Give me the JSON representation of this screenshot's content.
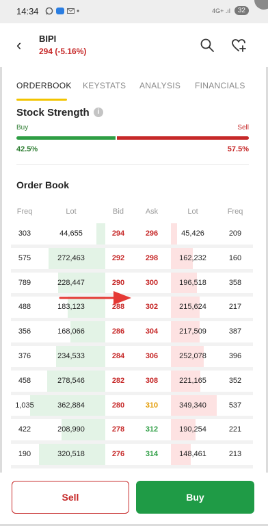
{
  "status_bar": {
    "time": "14:34",
    "icons": [
      "whatsapp-icon",
      "app-icon",
      "mail-icon",
      "dot-icon"
    ],
    "signal": "4G+ .ıl",
    "battery": "32"
  },
  "header": {
    "ticker": "BIPI",
    "price": "294",
    "change": "(-5.16%)"
  },
  "tabs": [
    "ORDERBOOK",
    "KEYSTATS",
    "ANALYSIS",
    "FINANCIALS"
  ],
  "active_tab": "ORDERBOOK",
  "stock_strength": {
    "title": "Stock Strength",
    "info": "i",
    "buy_label": "Buy",
    "sell_label": "Sell",
    "buy_pct": "42.5%",
    "sell_pct": "57.5%",
    "buy_fraction": 0.425
  },
  "order_book": {
    "title": "Order Book",
    "headers": {
      "freq_bid": "Freq",
      "lot_bid": "Lot",
      "bid": "Bid",
      "ask": "Ask",
      "lot_ask": "Lot",
      "freq_ask": "Freq"
    },
    "rows": [
      {
        "freq_bid": "303",
        "lot_bid": "44,655",
        "bid": "294",
        "ask": "296",
        "lot_ask": "45,426",
        "freq_ask": "209",
        "ask_color": "red",
        "bid_fill": 0.12,
        "ask_fill": 0.13
      },
      {
        "freq_bid": "575",
        "lot_bid": "272,463",
        "bid": "292",
        "ask": "298",
        "lot_ask": "162,232",
        "freq_ask": "160",
        "ask_color": "red",
        "bid_fill": 0.75,
        "ask_fill": 0.45
      },
      {
        "freq_bid": "789",
        "lot_bid": "228,447",
        "bid": "290",
        "ask": "300",
        "lot_ask": "196,518",
        "freq_ask": "358",
        "ask_color": "red",
        "bid_fill": 0.63,
        "ask_fill": 0.54
      },
      {
        "freq_bid": "488",
        "lot_bid": "183,123",
        "bid": "288",
        "ask": "302",
        "lot_ask": "215,624",
        "freq_ask": "217",
        "ask_color": "red",
        "bid_fill": 0.5,
        "ask_fill": 0.6
      },
      {
        "freq_bid": "356",
        "lot_bid": "168,066",
        "bid": "286",
        "ask": "304",
        "lot_ask": "217,509",
        "freq_ask": "387",
        "ask_color": "red",
        "bid_fill": 0.46,
        "ask_fill": 0.6
      },
      {
        "freq_bid": "376",
        "lot_bid": "234,533",
        "bid": "284",
        "ask": "306",
        "lot_ask": "252,078",
        "freq_ask": "396",
        "ask_color": "red",
        "bid_fill": 0.65,
        "ask_fill": 0.69
      },
      {
        "freq_bid": "458",
        "lot_bid": "278,546",
        "bid": "282",
        "ask": "308",
        "lot_ask": "221,165",
        "freq_ask": "352",
        "ask_color": "red",
        "bid_fill": 0.77,
        "ask_fill": 0.61
      },
      {
        "freq_bid": "1,035",
        "lot_bid": "362,884",
        "bid": "280",
        "ask": "310",
        "lot_ask": "349,340",
        "freq_ask": "537",
        "ask_color": "orange",
        "bid_fill": 1.0,
        "ask_fill": 0.96
      },
      {
        "freq_bid": "422",
        "lot_bid": "208,990",
        "bid": "278",
        "ask": "312",
        "lot_ask": "190,254",
        "freq_ask": "221",
        "ask_color": "green",
        "bid_fill": 0.58,
        "ask_fill": 0.52
      },
      {
        "freq_bid": "190",
        "lot_bid": "320,518",
        "bid": "276",
        "ask": "314",
        "lot_ask": "148,461",
        "freq_ask": "213",
        "ask_color": "green",
        "bid_fill": 0.88,
        "ask_fill": 0.41
      }
    ]
  },
  "actions": {
    "sell_label": "Sell",
    "buy_label": "Buy"
  },
  "colors": {
    "red": "#c62828",
    "green": "#1f9b46",
    "tab_accent": "#f2c400",
    "orange": "#e39a00"
  }
}
